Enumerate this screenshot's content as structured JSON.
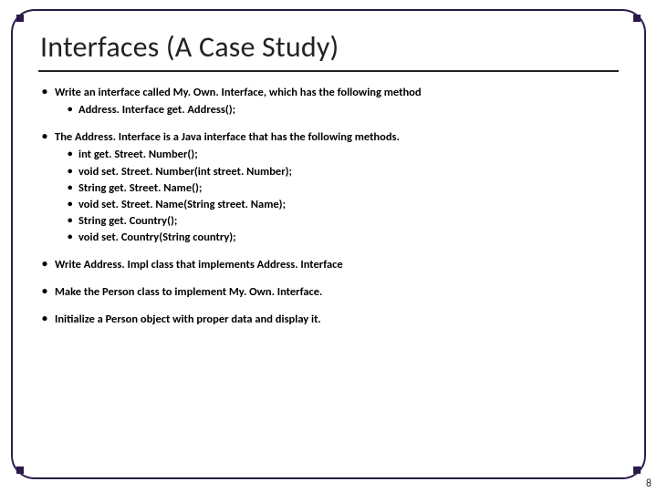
{
  "title": "Interfaces (A Case Study)",
  "bullets": {
    "b1": "Write an interface called My. Own. Interface, which has the following method",
    "b1_sub1": "Address. Interface get. Address();",
    "b2": "The Address. Interface is a Java interface that has the following methods.",
    "b2_sub1": "int get. Street. Number();",
    "b2_sub2": "void set. Street. Number(int street. Number);",
    "b2_sub3": "String get. Street. Name();",
    "b2_sub4": "void set. Street. Name(String street. Name);",
    "b2_sub5": "String get. Country();",
    "b2_sub6": "void set. Country(String country);",
    "b3": "Write Address. Impl class that implements Address. Interface",
    "b4": "Make the Person class to implement My. Own. Interface.",
    "b5": "Initialize a Person object with proper data and display it."
  },
  "page_number": "8"
}
